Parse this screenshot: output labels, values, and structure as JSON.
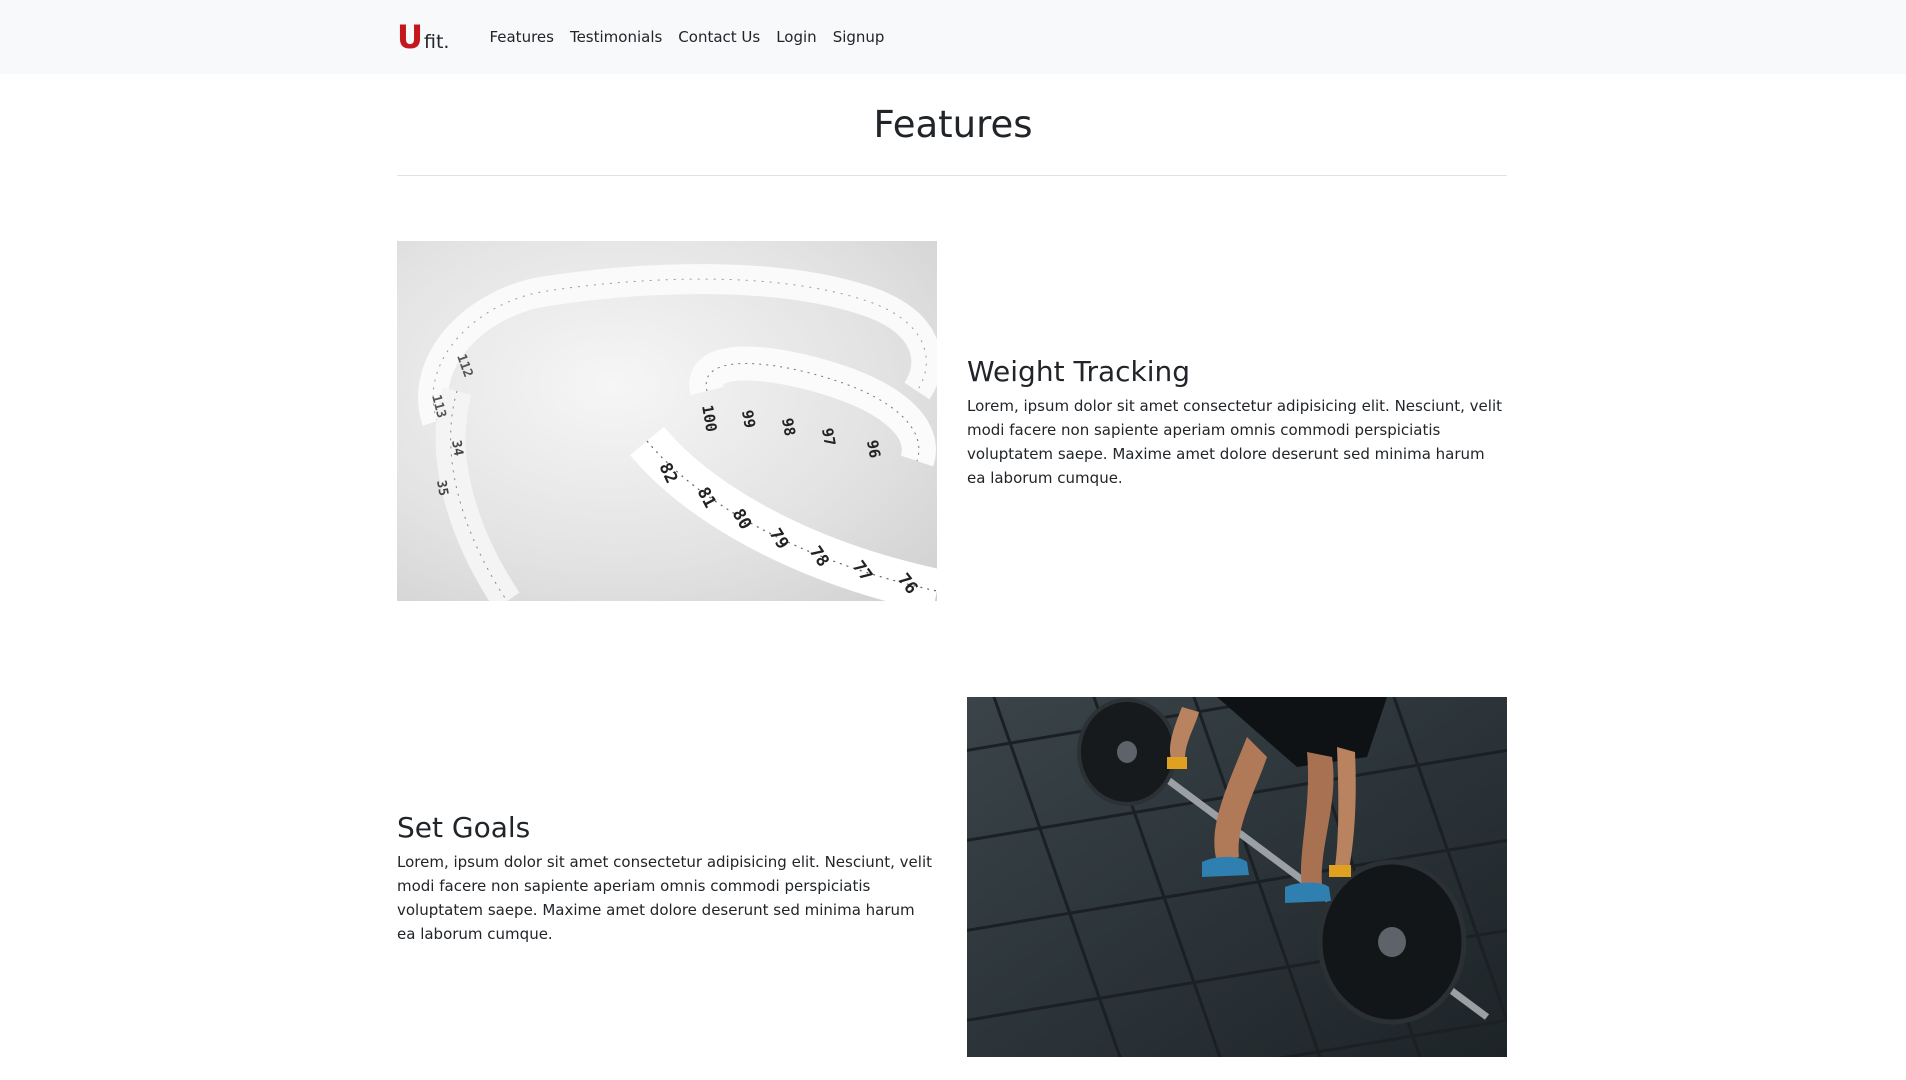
{
  "brand": {
    "letter": "U",
    "rest": "fit."
  },
  "nav": {
    "links": [
      "Features",
      "Testimonials",
      "Contact Us",
      "Login",
      "Signup"
    ]
  },
  "section": {
    "title": "Features"
  },
  "features": [
    {
      "heading": "Weight Tracking",
      "body": "Lorem, ipsum dolor sit amet consectetur adipisicing elit. Nesciunt, velit modi facere non sapiente aperiam omnis commodi perspiciatis voluptatem saepe. Maxime amet dolore deserunt sed minima harum ea laborum cumque.",
      "image": "measuring-tape-photo"
    },
    {
      "heading": "Set Goals",
      "body": "Lorem, ipsum dolor sit amet consectetur adipisicing elit. Nesciunt, velit modi facere non sapiente aperiam omnis commodi perspiciatis voluptatem saepe. Maxime amet dolore deserunt sed minima harum ea laborum cumque.",
      "image": "barbell-deadlift-photo"
    }
  ],
  "tape_numbers": [
    "82",
    "81",
    "80",
    "79",
    "78",
    "77",
    "76",
    "100",
    "99",
    "98",
    "97",
    "96",
    "113",
    "112",
    "35",
    "34"
  ],
  "colors": {
    "brand_red": "#c4161c",
    "navbar_bg": "#f8f9fa",
    "text": "#212529"
  }
}
